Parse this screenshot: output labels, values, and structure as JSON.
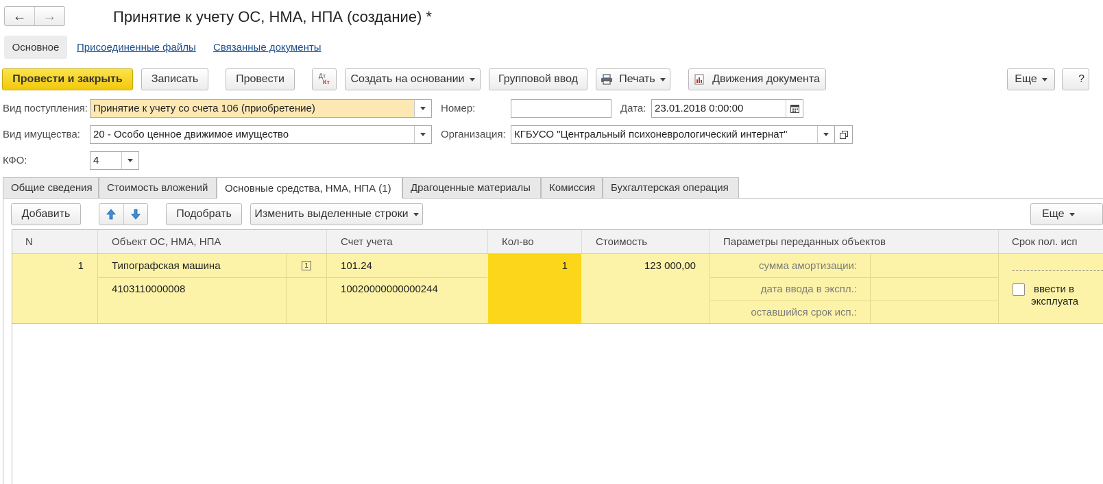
{
  "window": {
    "title": "Принятие к учету ОС, НМА, НПА (создание) *"
  },
  "nav": {
    "back_icon": "arrow-left-icon",
    "forward_icon": "arrow-right-icon"
  },
  "section_tabs": [
    {
      "label": "Основное",
      "active": true
    },
    {
      "label": "Присоединенные файлы"
    },
    {
      "label": "Связанные документы"
    }
  ],
  "toolbar": {
    "post_close": "Провести и закрыть",
    "save": "Записать",
    "post": "Провести",
    "dt_label": "Дт",
    "kt_label": "Кт",
    "create_based": "Создать на основании",
    "group_input": "Групповой ввод",
    "print": "Печать",
    "movements": "Движения документа",
    "more": "Еще",
    "help": "?"
  },
  "form": {
    "receipt_type_label": "Вид поступления:",
    "receipt_type_value": "Принятие к учету со счета 106 (приобретение)",
    "number_label": "Номер:",
    "number_value": "",
    "date_label": "Дата:",
    "date_value": "23.01.2018  0:00:00",
    "property_type_label": "Вид имущества:",
    "property_type_value": "20 - Особо ценное движимое имущество",
    "org_label": "Организация:",
    "org_value": "КГБУСО \"Центральный психоневрологический интернат\"",
    "kfo_label": "КФО:",
    "kfo_value": "4"
  },
  "tabs": [
    {
      "label": "Общие сведения"
    },
    {
      "label": "Стоимость вложений"
    },
    {
      "label": "Основные средства, НМА, НПА (1)",
      "active": true
    },
    {
      "label": "Драгоценные материалы"
    },
    {
      "label": "Комиссия"
    },
    {
      "label": "Бухгалтерская операция"
    }
  ],
  "table_toolbar": {
    "add": "Добавить",
    "pick": "Подобрать",
    "change_rows": "Изменить выделенные строки",
    "more": "Еще"
  },
  "table": {
    "columns": [
      "N",
      "Объект ОС, НМА, НПА",
      "Счет учета",
      "Кол-во",
      "Стоимость",
      "Параметры переданных объектов",
      "Срок пол. исп"
    ],
    "rows": [
      {
        "n": "1",
        "object_name": "Типографская машина",
        "object_code": "4103110000008",
        "account": "101.24",
        "account_code": "10020000000000244",
        "qty": "1",
        "cost": "123 000,00",
        "param_amort": "сумма амортизации:",
        "param_date": "дата ввода в экспл.:",
        "param_remaining": "оставшийся срок исп.:",
        "checkbox_label_1": "ввести в",
        "checkbox_label_2": "эксплуата"
      }
    ]
  },
  "colors": {
    "accent_yellow": "#f5cf17",
    "row_highlight": "#fdf3a8",
    "qty_cell": "#fcd61a",
    "field_highlight": "#fde8b3"
  }
}
